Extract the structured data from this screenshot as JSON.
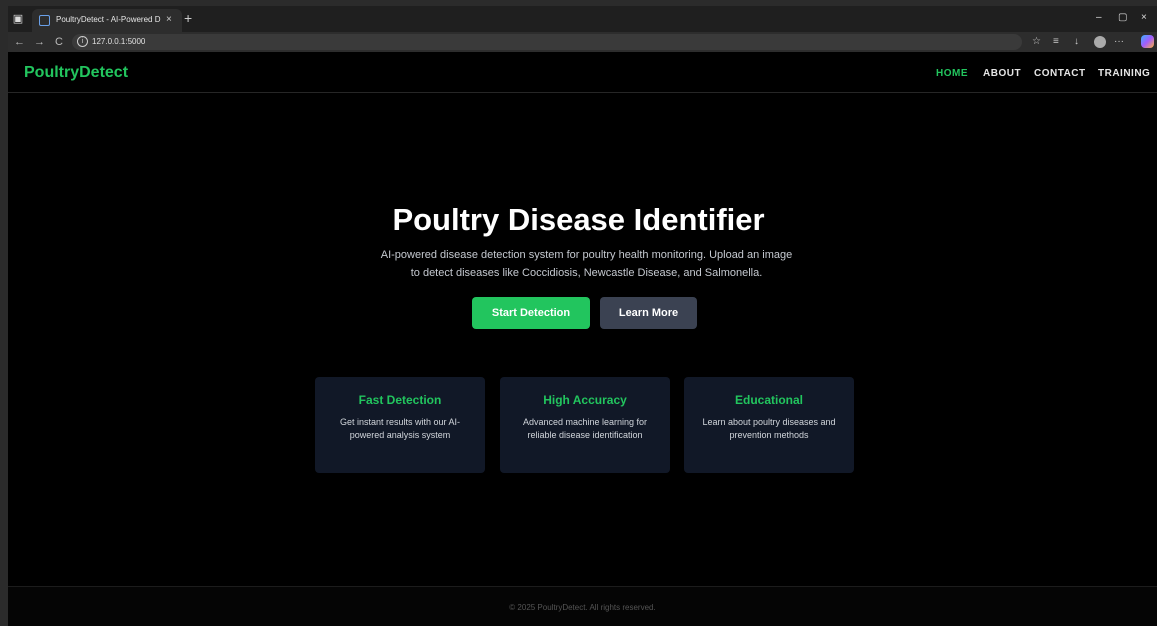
{
  "browser": {
    "tab_title": "PoultryDetect - AI-Powered Disea",
    "tab_close": "×",
    "new_tab": "+",
    "url": "127.0.0.1:5000",
    "window_controls": [
      "–",
      "▢",
      "×"
    ],
    "back": "←",
    "forward": "→",
    "reload": "C",
    "more": "···",
    "icons": [
      "favorites-icon",
      "collections-icon",
      "downloads-icon",
      "profile-icon",
      "more-icon",
      "copilot-icon"
    ]
  },
  "site": {
    "brand": "PoultryDetect",
    "nav": [
      {
        "label": "HOME",
        "active": true
      },
      {
        "label": "ABOUT",
        "active": false
      },
      {
        "label": "CONTACT",
        "active": false
      },
      {
        "label": "TRAINING",
        "active": false
      }
    ]
  },
  "hero": {
    "title": "Poultry Disease Identifier",
    "subtitle": "AI-powered disease detection system for poultry health monitoring. Upload an image to detect diseases like Coccidiosis, Newcastle Disease, and Salmonella.",
    "primary_button": "Start Detection",
    "secondary_button": "Learn More"
  },
  "features": [
    {
      "title": "Fast Detection",
      "description": "Get instant results with our AI-powered analysis system"
    },
    {
      "title": "High Accuracy",
      "description": "Advanced machine learning for reliable disease identification"
    },
    {
      "title": "Educational",
      "description": "Learn about poultry diseases and prevention methods"
    }
  ],
  "footer": {
    "text": "© 2025 PoultryDetect. All rights reserved."
  },
  "colors": {
    "accent": "#22c55e",
    "card_bg": "#111827",
    "secondary_button": "#3b4252",
    "page_bg": "#000000"
  }
}
